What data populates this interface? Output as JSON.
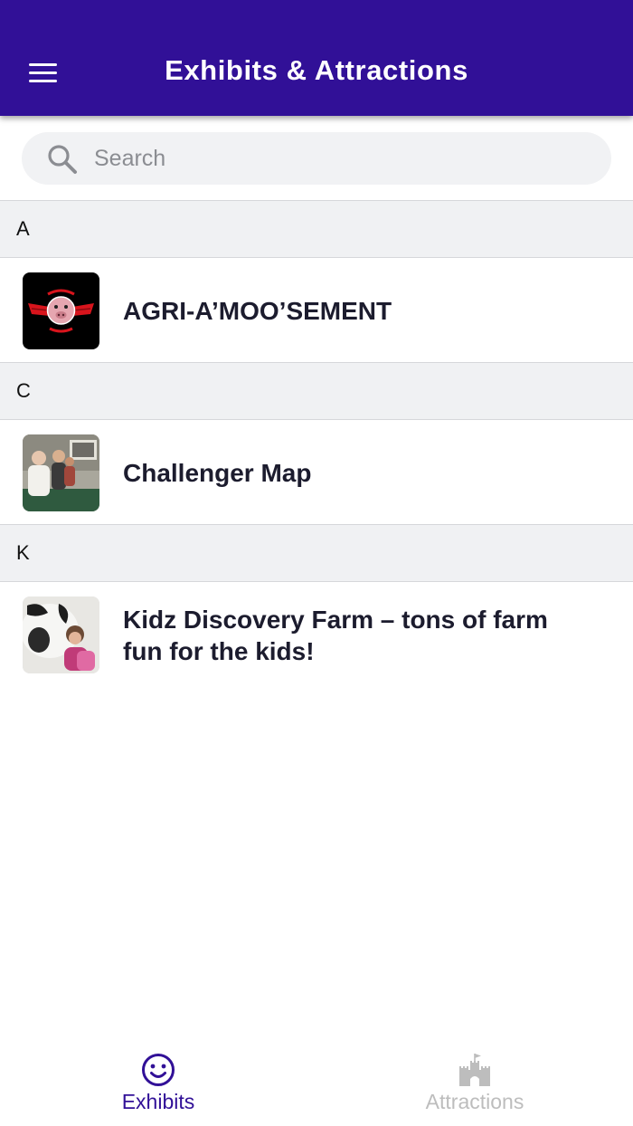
{
  "header": {
    "title": "Exhibits & Attractions",
    "menu_icon": "hamburger-menu-icon"
  },
  "search": {
    "placeholder": "Search",
    "value": "",
    "icon": "search-icon"
  },
  "sections": [
    {
      "letter": "A",
      "items": [
        {
          "title": "AGRI-A’MOO’SEMENT",
          "thumbnail": "winged-pig-logo"
        }
      ]
    },
    {
      "letter": "C",
      "items": [
        {
          "title": " Challenger Map",
          "thumbnail": "people-photo"
        }
      ]
    },
    {
      "letter": "K",
      "items": [
        {
          "title": " Kidz Discovery Farm – tons of farm fun for the kids!",
          "thumbnail": "child-with-cow-photo"
        }
      ]
    }
  ],
  "tabs": [
    {
      "label": "Exhibits",
      "icon": "smiley-icon",
      "active": true
    },
    {
      "label": "Attractions",
      "icon": "castle-icon",
      "active": false
    }
  ],
  "colors": {
    "header_bg": "#311097",
    "active_tab": "#311097",
    "inactive_tab": "#bdbdbd",
    "section_bg": "#f0f1f3"
  }
}
